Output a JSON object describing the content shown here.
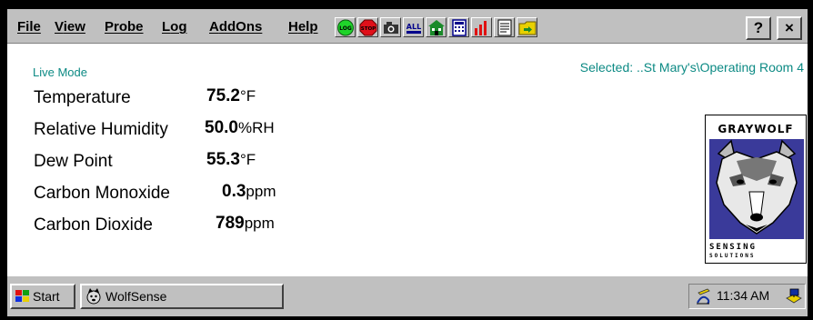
{
  "menu": {
    "items": [
      {
        "first": "F",
        "rest": "ile"
      },
      {
        "first": "V",
        "rest": "iew"
      },
      {
        "first": "P",
        "rest": "robe"
      },
      {
        "first": "L",
        "rest": "og"
      },
      {
        "first": "A",
        "rest": "ddOns"
      },
      {
        "first": "H",
        "rest": "elp"
      }
    ],
    "help_button": "?",
    "close_button": "×"
  },
  "toolbar": {
    "log_icon_text": "LOG",
    "stop_icon_text": "STOP",
    "all_icon_text": "ALL",
    "log_color": "#1fd42a",
    "stop_color": "#e0101a"
  },
  "content": {
    "mode": "Live Mode",
    "selected": "Selected: ..St Mary's\\Operating Room 4",
    "accent_color": "#0c8a84",
    "readings": [
      {
        "label": "Temperature",
        "value": "75.2",
        "unit": "°F"
      },
      {
        "label": "Relative Humidity",
        "value": "50.0",
        "unit": "%RH"
      },
      {
        "label": "Dew Point",
        "value": "55.3",
        "unit": "°F"
      },
      {
        "label": "Carbon Monoxide",
        "value": "0.3",
        "unit": "ppm"
      },
      {
        "label": "Carbon Dioxide",
        "value": "789",
        "unit": "ppm"
      }
    ]
  },
  "logo": {
    "title": "GRAYWOLF",
    "line1": "SENSING",
    "line2": "SOLUTIONS"
  },
  "taskbar": {
    "start_label": "Start",
    "app_label": "WolfSense",
    "clock": "11:34 AM"
  }
}
